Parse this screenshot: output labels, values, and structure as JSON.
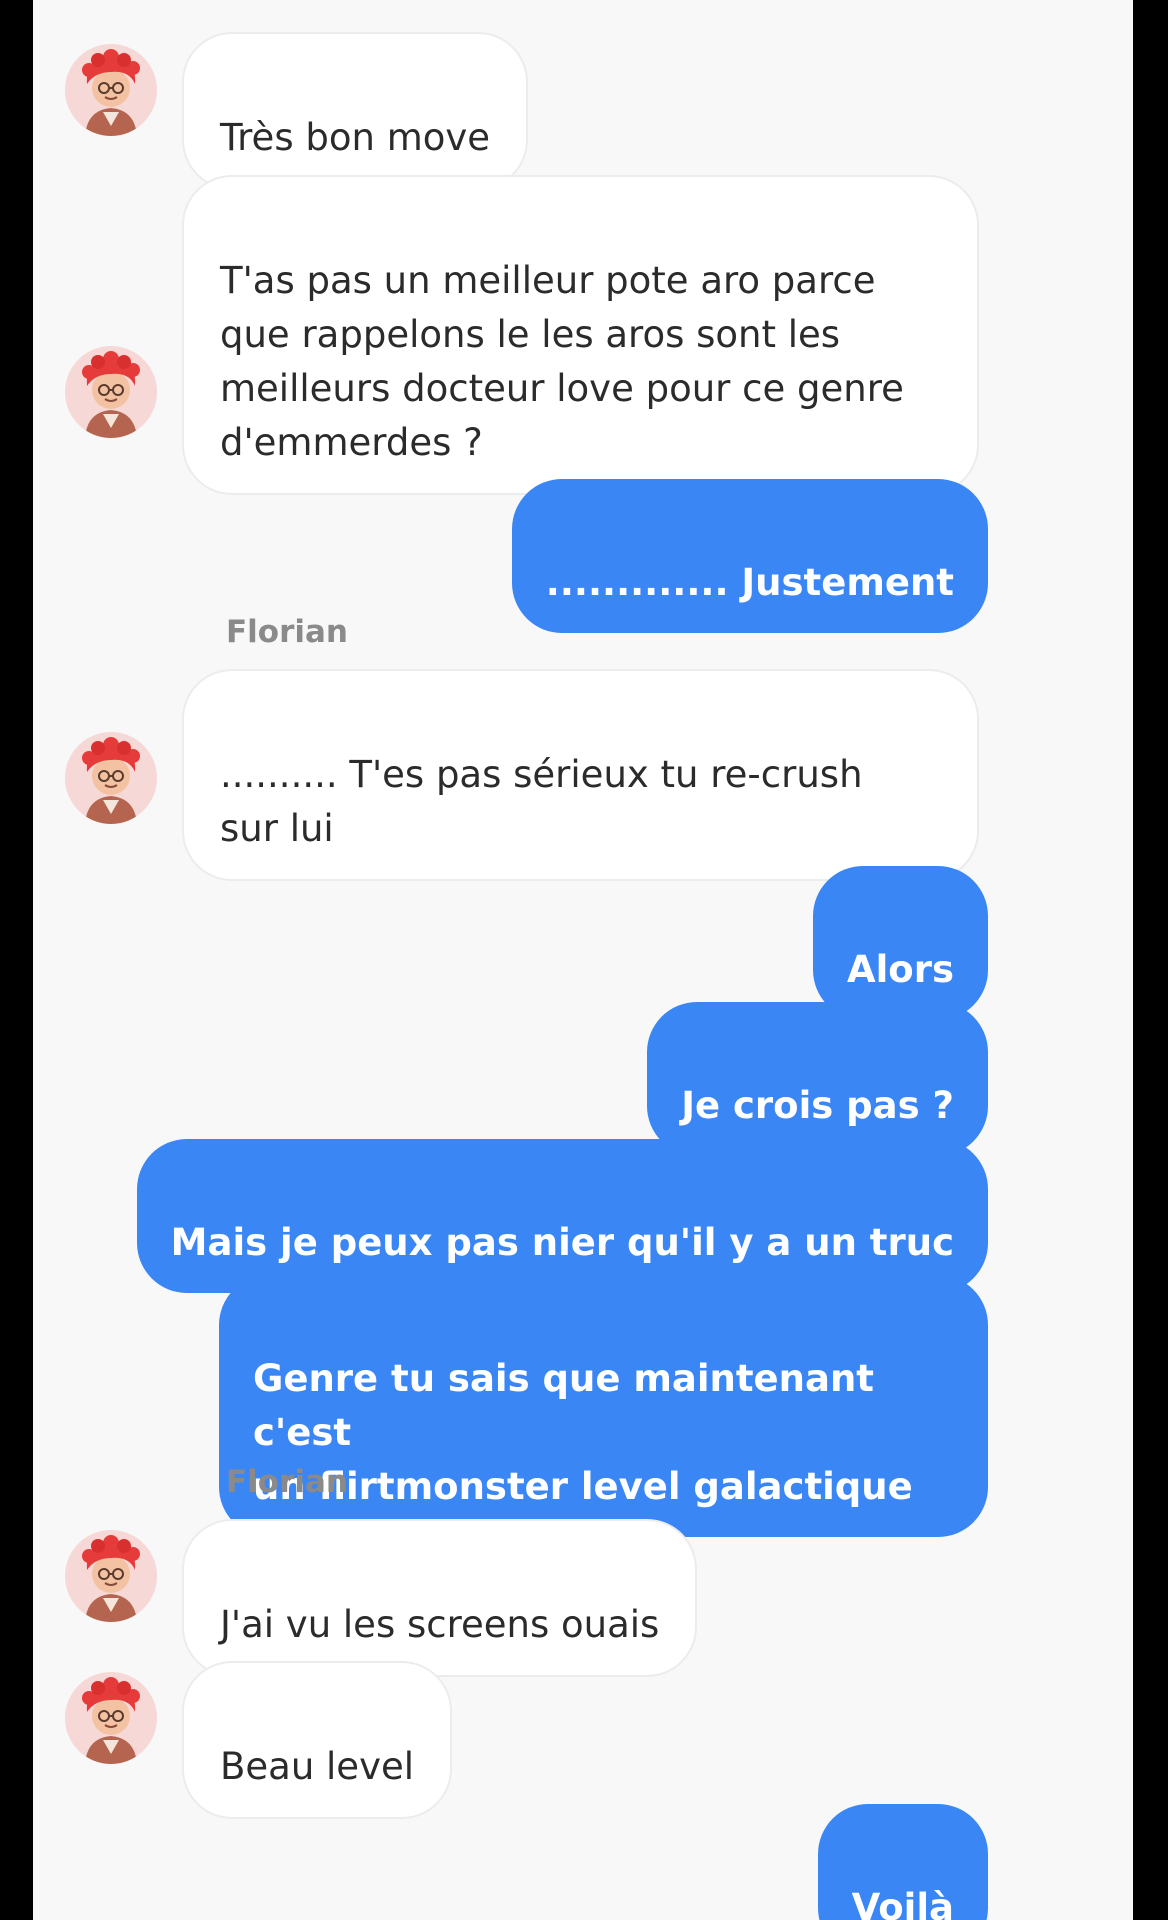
{
  "contact": {
    "name": "Florian",
    "avatar_icon": "avatar-red-hair-glasses"
  },
  "colors": {
    "outgoing_bubble": "#3a86f4",
    "incoming_bubble": "#ffffff",
    "background": "#f8f8f8"
  },
  "messages": [
    {
      "direction": "in",
      "text": "Très bon move"
    },
    {
      "direction": "in",
      "text": "T'as pas un meilleur pote aro parce\nque rappelons le les aros sont les\nmeilleurs docteur love pour ce genre\nd'emmerdes ?"
    },
    {
      "direction": "out",
      "text": "............. Justement"
    },
    {
      "direction": "in",
      "sender": "Florian",
      "text": ".......... T'es pas sérieux tu re-crush\nsur lui"
    },
    {
      "direction": "out",
      "text": "Alors"
    },
    {
      "direction": "out",
      "text": "Je crois pas ?"
    },
    {
      "direction": "out",
      "text": "Mais je peux pas nier qu'il y a un truc"
    },
    {
      "direction": "out",
      "text": "Genre tu sais que maintenant c'est\nun flirtmonster level galactique"
    },
    {
      "direction": "in",
      "sender": "Florian",
      "text": "J'ai vu les screens ouais"
    },
    {
      "direction": "in",
      "text": "Beau level"
    },
    {
      "direction": "out",
      "text": "Voilà"
    }
  ]
}
